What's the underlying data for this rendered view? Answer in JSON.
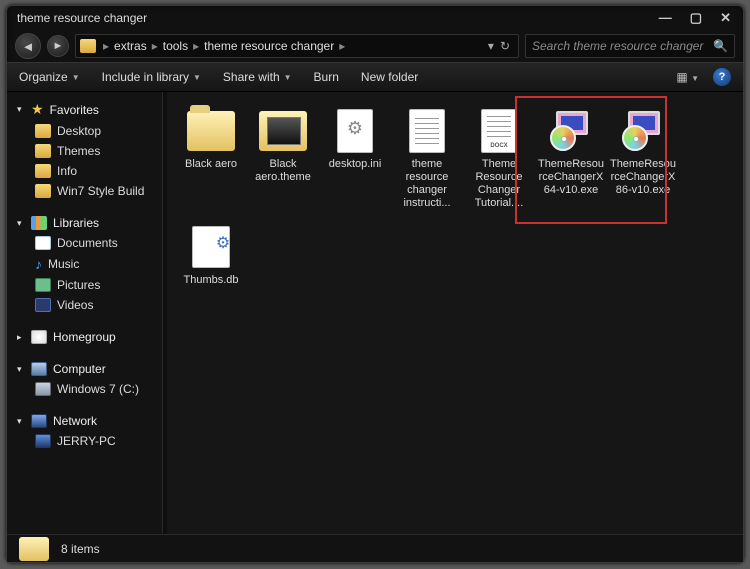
{
  "window": {
    "title": "theme resource changer"
  },
  "breadcrumbs": [
    "extras",
    "tools",
    "theme resource changer"
  ],
  "search": {
    "placeholder": "Search theme resource changer"
  },
  "toolbar": {
    "organize": "Organize",
    "include": "Include in library",
    "share": "Share with",
    "burn": "Burn",
    "newfolder": "New folder"
  },
  "sidebar": {
    "favorites": {
      "label": "Favorites",
      "items": [
        "Desktop",
        "Themes",
        "Info",
        "Win7 Style Build"
      ]
    },
    "libraries": {
      "label": "Libraries",
      "items": [
        "Documents",
        "Music",
        "Pictures",
        "Videos"
      ]
    },
    "homegroup": {
      "label": "Homegroup"
    },
    "computer": {
      "label": "Computer",
      "items": [
        "Windows 7 (C:)"
      ]
    },
    "network": {
      "label": "Network",
      "items": [
        "JERRY-PC"
      ]
    }
  },
  "files": [
    {
      "name": "Black aero",
      "type": "folder"
    },
    {
      "name": "Black aero.theme",
      "type": "folder-filled"
    },
    {
      "name": "desktop.ini",
      "type": "ini"
    },
    {
      "name": "theme resource changer instructi...",
      "type": "txt"
    },
    {
      "name": "Theme Resource Changer Tutorial....",
      "type": "docx"
    },
    {
      "name": "ThemeResourceChangerX64-v10.exe",
      "type": "exe"
    },
    {
      "name": "ThemeResourceChangerX86-v10.exe",
      "type": "exe"
    },
    {
      "name": "Thumbs.db",
      "type": "db"
    }
  ],
  "status": {
    "count": "8 items"
  }
}
